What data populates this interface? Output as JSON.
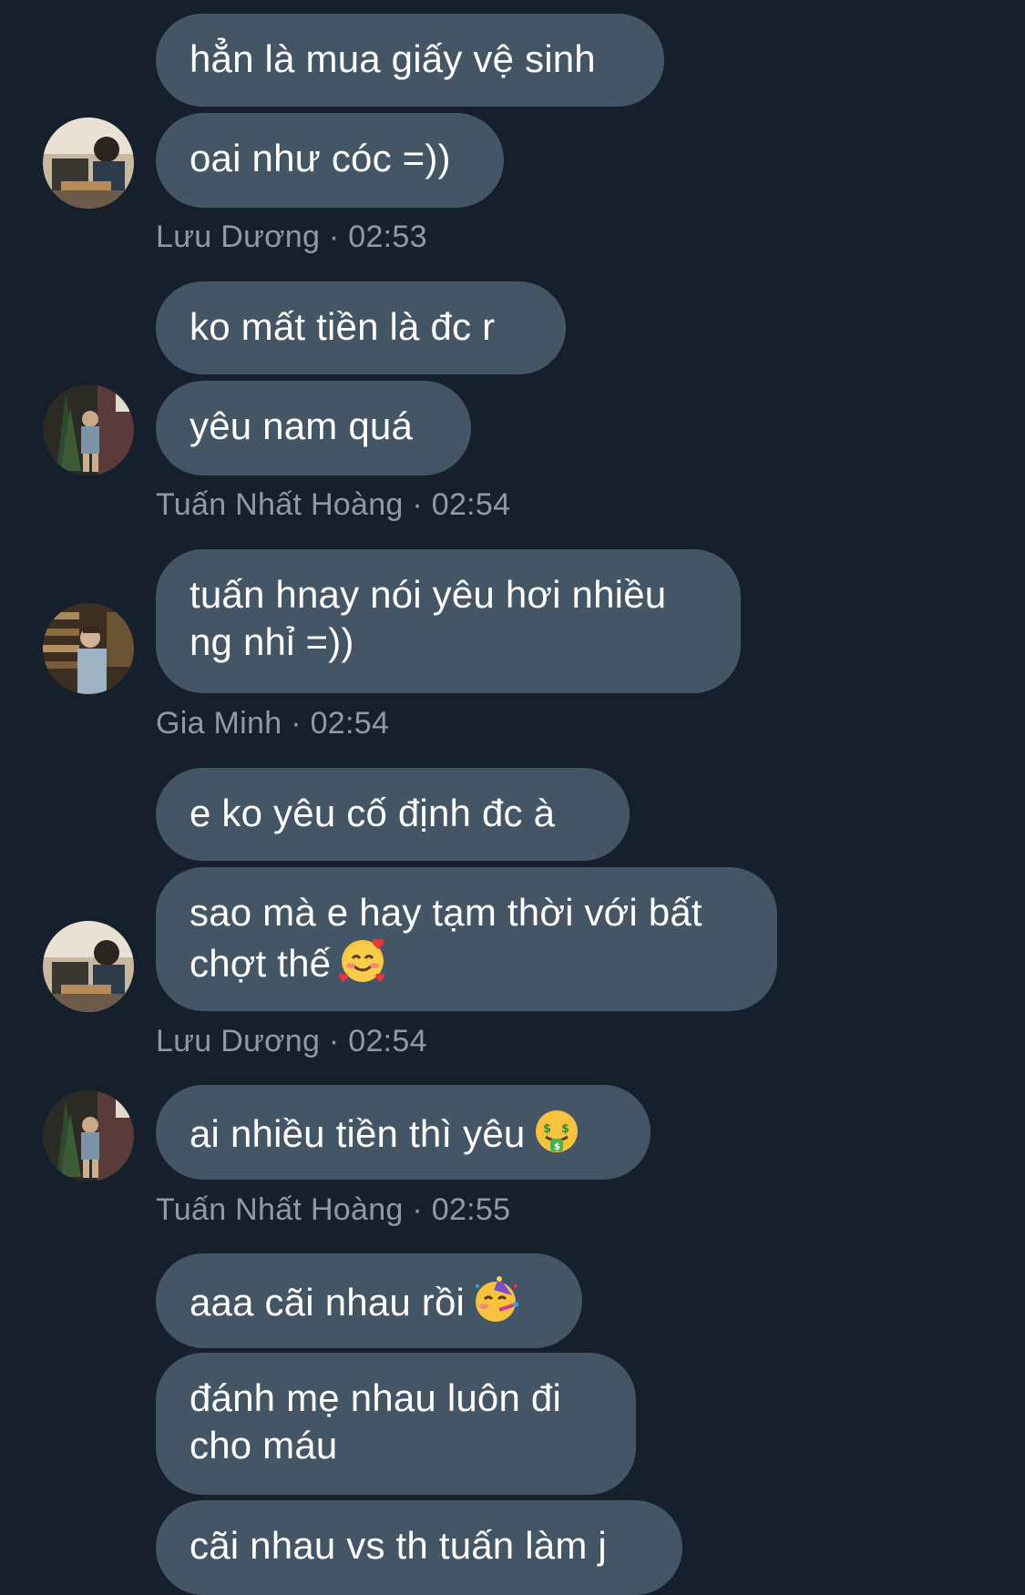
{
  "messages": {
    "m1": "hẳn là mua giấy vệ sinh",
    "m2": "oai như cóc =))",
    "meta1": "Lưu Dương · 02:53",
    "m3": "ko mất tiền là đc r",
    "m4": "yêu nam quá",
    "meta2": "Tuấn Nhất Hoàng · 02:54",
    "m5": "tuấn hnay nói yêu hơi nhiều ng nhỉ =))",
    "meta3": "Gia Minh · 02:54",
    "m6": "e ko yêu cố định đc à",
    "m7": "sao mà e hay tạm thời với bất chợt thế",
    "meta4": "Lưu Dương · 02:54",
    "m8": "ai nhiều tiền thì yêu",
    "meta5": "Tuấn Nhất Hoàng · 02:55",
    "m9": "aaa cãi nhau rồi",
    "m10": "đánh mẹ nhau luôn đi cho máu",
    "m11": "cãi nhau vs th tuấn làm j"
  },
  "emojis": {
    "m7": "smiling-face-with-hearts-icon",
    "m8": "money-mouth-face-icon",
    "m9": "partying-face-icon"
  },
  "colors": {
    "background": "#16202d",
    "bubble": "#445566",
    "meta_text": "#8f9aa7"
  }
}
